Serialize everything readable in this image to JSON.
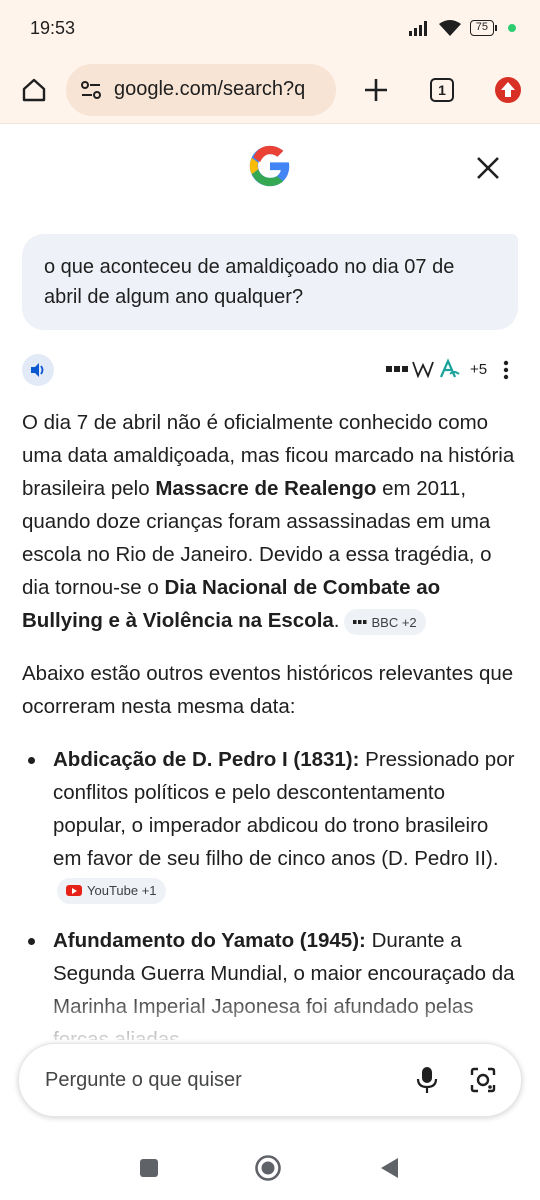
{
  "status_bar": {
    "time": "19:53",
    "battery": "75"
  },
  "browser": {
    "url": "google.com/search?q",
    "tab_count": "1"
  },
  "query": {
    "text": "o que aconteceu de amaldiçoado no dia 07 de abril de algum ano qualquer?"
  },
  "sources": {
    "more_count": "+5"
  },
  "answer": {
    "p1_a": "O dia 7 de abril não é oficialmente conhecido como uma data amaldiçoada, mas ficou marcado na história brasileira pelo ",
    "p1_b1": "Massacre de Realengo",
    "p1_c": " em 2011, quando doze crianças foram assassinadas em uma escola no Rio de Janeiro. Devido a essa tragédia, o dia tornou-se o ",
    "p1_b2": "Dia Nacional de Combate ao Bullying e à Violência na Escola",
    "p1_d": ".",
    "p1_cite": "BBC +2",
    "p2": "Abaixo estão outros eventos históricos relevantes que ocorreram nesta mesma data:",
    "bullets": [
      {
        "title": "Abdicação de D. Pedro I (1831):",
        "text": " Pressionado por conflitos políticos e pelo descontentamento popular, o imperador abdicou do trono brasileiro em favor de seu filho de cinco anos (D. Pedro II).",
        "cite": "YouTube +1"
      },
      {
        "title": "Afundamento do Yamato (1945):",
        "text": " Durante a Segunda Guerra Mundial, o maior encouraçado da Marinha Imperial Japonesa foi afundado pelas forças aliadas."
      }
    ]
  },
  "ask_bar": {
    "placeholder": "Pergunte o que quiser"
  }
}
